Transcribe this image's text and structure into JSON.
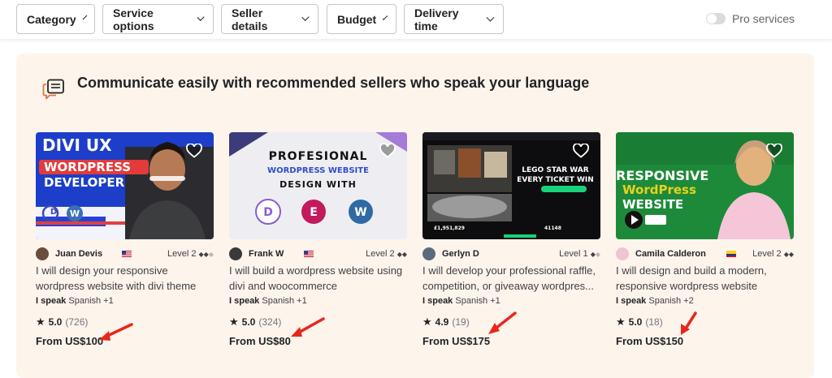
{
  "filters": [
    {
      "label": "Category"
    },
    {
      "label": "Service options"
    },
    {
      "label": "Seller details"
    },
    {
      "label": "Budget"
    },
    {
      "label": "Delivery time"
    }
  ],
  "pro_toggle": {
    "label": "Pro services",
    "on": false
  },
  "section": {
    "title": "Communicate easily with recommended sellers who speak your language"
  },
  "cards": [
    {
      "thumb_lines": [
        "DIVI UX",
        "WORDPRESS",
        "DEVELOPER"
      ],
      "seller": "Juan Devis",
      "level": "Level 2",
      "title_line1": "I will design your responsive",
      "title_line2": "wordpress website with divi theme",
      "speak_label": "I speak",
      "language": "Spanish +1",
      "rating": "5.0",
      "reviews": "(726)",
      "price": "From US$100"
    },
    {
      "thumb_lines": [
        "PROFESIONAL",
        "WORDPRESS WEBSITE",
        "DESIGN WITH"
      ],
      "seller": "Frank W",
      "level": "Level 2",
      "title_line1": "I will build a wordpress website using",
      "title_line2": "divi and woocommerce",
      "speak_label": "I speak",
      "language": "Spanish +1",
      "rating": "5.0",
      "reviews": "(324)",
      "price": "From US$80"
    },
    {
      "thumb_lines": [
        "LEGO STAR WAR",
        "EVERY TICKET WIN"
      ],
      "seller": "Gerlyn D",
      "level": "Level 1",
      "title_line1": "I will develop your professional raffle,",
      "title_line2": "competition, or giveaway wordpres...",
      "speak_label": "I speak",
      "language": "Spanish +1",
      "rating": "4.9",
      "reviews": "(19)",
      "price": "From US$175"
    },
    {
      "thumb_lines": [
        "RESPONSIVE",
        "WordPress",
        "WEBSITE"
      ],
      "seller": "Camila Calderon",
      "level": "Level 2",
      "title_line1": "I will design and build a modern,",
      "title_line2": "responsive wordpress website",
      "speak_label": "I speak",
      "language": "Spanish +2",
      "rating": "5.0",
      "reviews": "(18)",
      "price": "From US$150"
    }
  ],
  "colors": {
    "arrow": "#e8261e",
    "panel": "#fdf4ec"
  }
}
